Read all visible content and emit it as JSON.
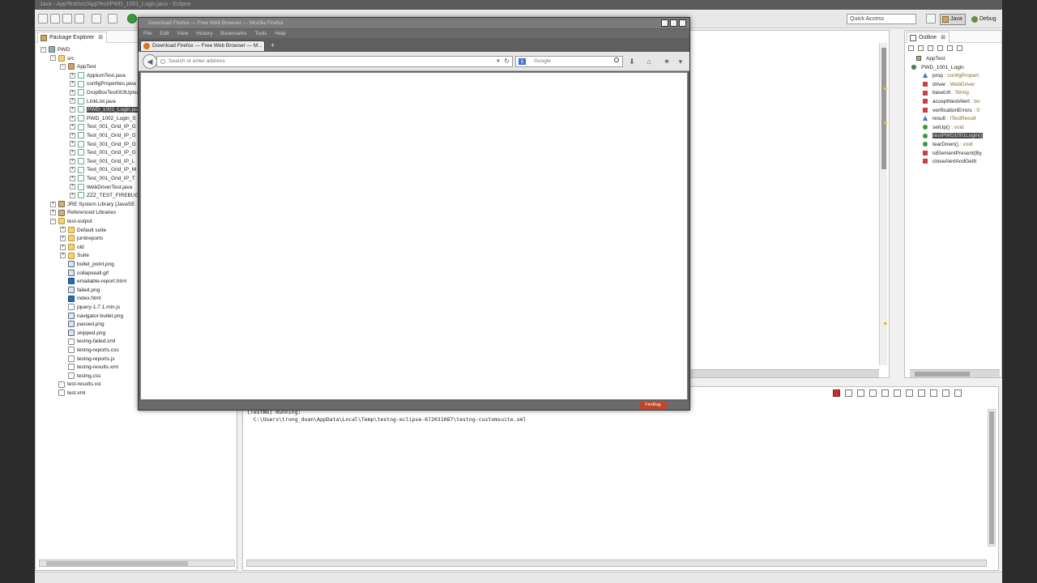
{
  "window": {
    "title": "Java - AppTest/src/AppTest/PWD_1001_Login.java - Eclipse"
  },
  "toolbar": {
    "quick_access": "Quick Access",
    "persp_java": "Java",
    "persp_debug": "Debug"
  },
  "package_explorer": {
    "title": "Package Explorer",
    "close": "⊠",
    "items": [
      {
        "label": "PWD",
        "icon": "project-icon",
        "exp": "−"
      },
      {
        "label": "src",
        "icon": "folder-icon",
        "exp": "−"
      },
      {
        "label": "AppTest",
        "icon": "package-icon",
        "exp": "−"
      },
      {
        "label": "AppiumTest.java",
        "icon": "java-file-icon",
        "exp": "+"
      },
      {
        "label": "configProperties.java",
        "icon": "java-file-icon",
        "exp": "+"
      },
      {
        "label": "DropBoxTest003Uploa",
        "icon": "java-file-icon",
        "exp": "+"
      },
      {
        "label": "LinkList.java",
        "icon": "java-file-icon",
        "exp": "+"
      },
      {
        "label": "PWD_1001_Login.java",
        "icon": "java-file-icon",
        "exp": "+",
        "selected": true
      },
      {
        "label": "PWD_1002_Login_S",
        "icon": "java-file-icon",
        "exp": "+"
      },
      {
        "label": "Test_001_Grid_IP_G",
        "icon": "java-file-icon",
        "exp": "+"
      },
      {
        "label": "Test_001_Grid_IP_G",
        "icon": "java-file-icon",
        "exp": "+"
      },
      {
        "label": "Test_001_Grid_IP_G",
        "icon": "java-file-icon",
        "exp": "+"
      },
      {
        "label": "Test_001_Grid_IP_G",
        "icon": "java-file-icon",
        "exp": "+"
      },
      {
        "label": "Test_001_Grid_IP_L",
        "icon": "java-file-icon",
        "exp": "+"
      },
      {
        "label": "Test_001_Grid_IP_M",
        "icon": "java-file-icon",
        "exp": "+"
      },
      {
        "label": "Test_001_Grid_IP_T",
        "icon": "java-file-icon",
        "exp": "+"
      },
      {
        "label": "WebDriverTest.java",
        "icon": "java-file-icon",
        "exp": "+"
      },
      {
        "label": "ZZZ_TEST_FIREBUG",
        "icon": "java-file-icon",
        "exp": "+"
      },
      {
        "label": "JRE System Library [JavaSE",
        "icon": "library-icon",
        "exp": "+"
      },
      {
        "label": "Referenced Libraries",
        "icon": "library-icon",
        "exp": "+"
      },
      {
        "label": "test-output",
        "icon": "folder-icon",
        "exp": "−"
      },
      {
        "label": "Default suite",
        "icon": "folder-icon",
        "exp": "+"
      },
      {
        "label": "junitreports",
        "icon": "folder-icon",
        "exp": "+"
      },
      {
        "label": "old",
        "icon": "folder-icon",
        "exp": "+"
      },
      {
        "label": "Suite",
        "icon": "folder-icon",
        "exp": "+"
      },
      {
        "label": "bullet_point.png",
        "icon": "image-file-icon",
        "exp": ""
      },
      {
        "label": "collapseall.gif",
        "icon": "image-file-icon",
        "exp": ""
      },
      {
        "label": "emailable-report.html",
        "icon": "html-file-icon",
        "exp": ""
      },
      {
        "label": "failed.png",
        "icon": "image-file-icon",
        "exp": ""
      },
      {
        "label": "index.html",
        "icon": "html-file-icon",
        "exp": ""
      },
      {
        "label": "jquery-1.7.1.min.js",
        "icon": "text-file-icon",
        "exp": ""
      },
      {
        "label": "navigator-bullet.png",
        "icon": "image-file-icon",
        "exp": ""
      },
      {
        "label": "passed.png",
        "icon": "image-file-icon",
        "exp": ""
      },
      {
        "label": "skipped.png",
        "icon": "image-file-icon",
        "exp": ""
      },
      {
        "label": "testng-failed.xml",
        "icon": "text-file-icon",
        "exp": ""
      },
      {
        "label": "testng-reports.css",
        "icon": "text-file-icon",
        "exp": ""
      },
      {
        "label": "testng-reports.js",
        "icon": "text-file-icon",
        "exp": ""
      },
      {
        "label": "testng-results.xml",
        "icon": "text-file-icon",
        "exp": ""
      },
      {
        "label": "testng.css",
        "icon": "text-file-icon",
        "exp": ""
      },
      {
        "label": "test-results.xsl",
        "icon": "text-file-icon",
        "exp": ""
      },
      {
        "label": "test.xml",
        "icon": "text-file-icon",
        "exp": ""
      }
    ]
  },
  "outline": {
    "title": "Outline",
    "close": "⊠",
    "items": [
      {
        "name": "AppTest",
        "type": ""
      },
      {
        "name": "PWD_1001_Login",
        "type": ""
      },
      {
        "name": "prop",
        "type": " : configPropert"
      },
      {
        "name": "driver",
        "type": " : WebDriver"
      },
      {
        "name": "baseUrl",
        "type": " : String"
      },
      {
        "name": "acceptNextAlert",
        "type": " : bo"
      },
      {
        "name": "verificationErrors",
        "type": " : S"
      },
      {
        "name": "result",
        "type": " : ITestResult"
      },
      {
        "name": "setUp()",
        "type": " : void"
      },
      {
        "name": "testPWD1001Login()",
        "type": "",
        "selected": true
      },
      {
        "name": "tearDown()",
        "type": " : void"
      },
      {
        "name": "isElementPresent(By",
        "type": ""
      },
      {
        "name": "closeAlertAndGetIt",
        "type": ""
      }
    ]
  },
  "console": {
    "lines": [
      "[TestNG] Running:",
      "  C:\\Users\\trong_doan\\AppData\\Local\\Temp\\testng-eclipse-672031087\\testng-customsuite.xml"
    ]
  },
  "firefox": {
    "title": "Download Firefox — Free Web Browser — Mozilla Firefox",
    "menus": [
      "File",
      "Edit",
      "View",
      "History",
      "Bookmarks",
      "Tools",
      "Help"
    ],
    "tab_title": "Download Firefox — Free Web Browser — M...",
    "new_tab": "+",
    "url_placeholder": "Search or enter address",
    "search_engine": "Google",
    "search_logo": "g",
    "firebug": "FireBug"
  },
  "colors": {
    "accent": "#e2731a",
    "selection": "#4a4a4a"
  }
}
